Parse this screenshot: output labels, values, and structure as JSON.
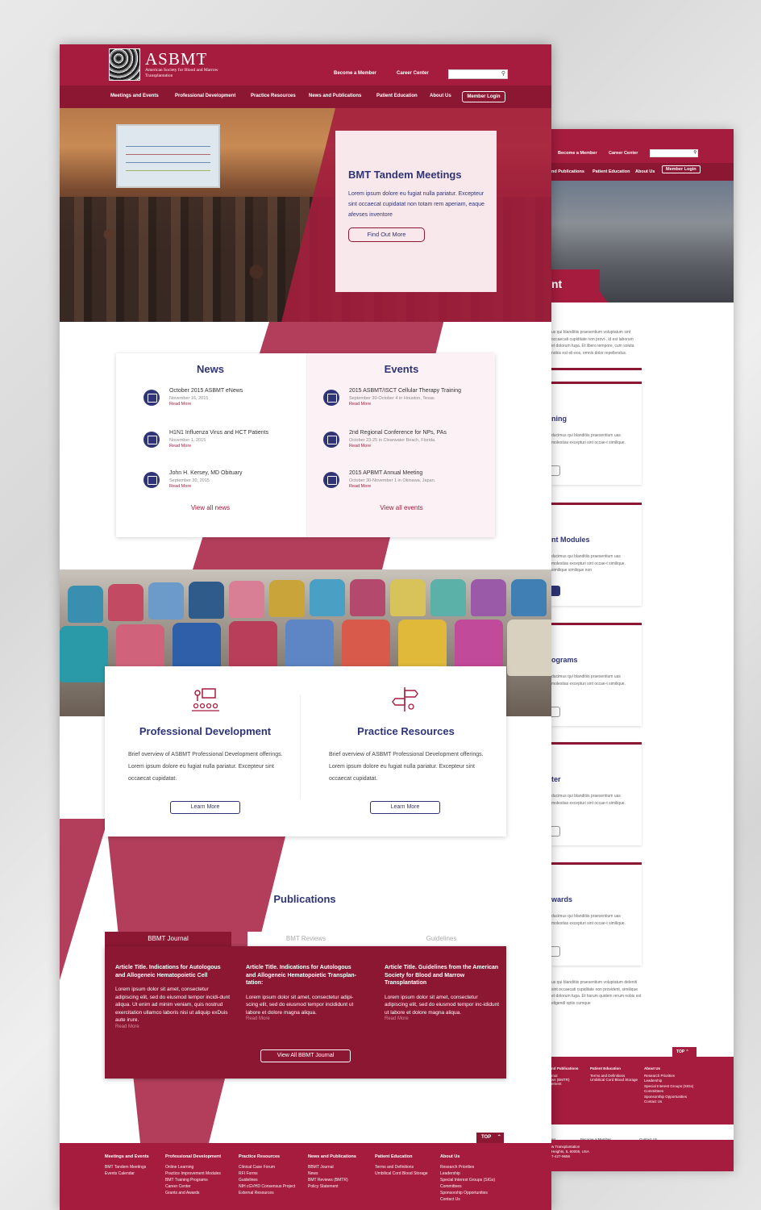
{
  "header": {
    "logo_text": "ASBMT",
    "logo_tm": "TM",
    "logo_subtitle": "American Society for Blood and Marrow Transplantation",
    "become_member": "Become a Member",
    "career_center": "Career Center",
    "search_icon": "magnifier-icon"
  },
  "nav": {
    "items": [
      "Meetings and Events",
      "Professional Development",
      "Practice Resources",
      "News and  Publications",
      "Patient Education",
      "About Us"
    ],
    "login": "Member Login"
  },
  "hero": {
    "title": "BMT Tandem Meetings",
    "body": "Lorem ipsum dolore eu fugiat nulla pariatur. Excepteur sint occaecat cupidatat non totam rem aperiam, eaque afevses inventore",
    "button": "Find Out More"
  },
  "news": {
    "title": "News",
    "items": [
      {
        "title": "October 2015 ASBMT eNews",
        "date": "November 16, 2015",
        "more": "Read More"
      },
      {
        "title": "H1N1 Influenza Virus and HCT Patients",
        "date": "November 1, 2015",
        "more": "Read More"
      },
      {
        "title": "John H. Kersey, MD Obituary",
        "date": "September 30, 2015",
        "more": "Read More"
      }
    ],
    "view_all": "View all news"
  },
  "events": {
    "title": "Events",
    "items": [
      {
        "title": "2015 ASBMT/ISCT Cellular Therapy Training",
        "date": "September 30-October 4 in Houston, Texas.",
        "more": "Read More"
      },
      {
        "title": "2nd Regional Conference for NPs, PAs",
        "date": "October 23-25 in Clearwater Beach, Florida.",
        "more": "Read More"
      },
      {
        "title": "2015 APBMT Annual Meeting",
        "date": "October 30-November 1 in Okinawa, Japan.",
        "more": "Read More"
      }
    ],
    "view_all": "View all events"
  },
  "features": [
    {
      "title": "Professional Development",
      "body": "Brief overview of ASBMT Professional Development offerings.  Lorem ipsum dolore eu fugiat nulla pariatur. Excepteur sint occaecat cupidatat.",
      "button": "Learn More"
    },
    {
      "title": "Practice Resources",
      "body": "Brief overview of ASBMT Professional Development offerings.  Lorem ipsum dolore eu fugiat nulla pariatur. Excepteur sint occaecat cupidatat.",
      "button": "Learn More"
    }
  ],
  "publications": {
    "title": "Publications",
    "tabs": [
      "BBMT Journal",
      "BMT Reviews",
      "Guidelines"
    ],
    "articles": [
      {
        "title": "Article Title. Indications for Autologous and Allogeneic Hematopoietic Cell",
        "body": "Lorem ipsum dolor sit amet, consectetur adipiscing elit, sed do eiusmod tempor incidi-dunt  aliqua. Ut enim ad minim veniam, quis nostrud exercitation ullamco laboris nisi ut aliquip exDuis aute irure.",
        "more": "Read More"
      },
      {
        "title": "Article Title. Indications for Autologous and Allogeneic Hematopoietic Transplan-tation:",
        "body": "Lorem ipsum dolor sit amet, consectetur adipi-scing elit, sed do eiusmod tempor incididunt ut labore et dolore magna aliqua.",
        "more": "Read More"
      },
      {
        "title": "Article Title. Guidelines from the American Society for Blood and Marrow Transplantation",
        "body": "Lorem ipsum dolor sit amet, consectetur adipiscing elit, sed do eiusmod tempor inc-ididunt ut labore et dolore magna aliqua.",
        "more": "Read More"
      }
    ],
    "view_all": "View All BBMT Journal"
  },
  "top_label": "TOP",
  "footer": {
    "columns": [
      {
        "heading": "Meetings and Events",
        "links": [
          "BMT Tandem Meetings",
          "Events Calendar"
        ]
      },
      {
        "heading": "Professional Development",
        "links": [
          "Online Learning",
          "Practice Improvement Modules",
          "BMT Training Programs",
          "Career Center",
          "Grants and Awards"
        ]
      },
      {
        "heading": "Practice Resources",
        "links": [
          "Clinical Case Forum",
          "RFI Forms",
          "Guidelines",
          "NIH cGVHD Consensus Project",
          "External Resources"
        ]
      },
      {
        "heading": "News and Publications",
        "links": [
          "BBMT Journal",
          "News",
          "BMT Reviews (BMTR)",
          "Policy Statement"
        ]
      },
      {
        "heading": "Patient Education",
        "links": [
          "Terms and Definitions",
          "Umbilical Cord Blood Storage"
        ]
      },
      {
        "heading": "About Us",
        "links": [
          "Research Priorities",
          "Leadership",
          "Special Interest Groups (SIGs)",
          "Committees",
          "Sponsorship Opportunities",
          "Contact Us"
        ]
      }
    ]
  },
  "back_page": {
    "become_member": "Become a Member",
    "career_center": "Career Center",
    "nav": [
      "nd Publications",
      "Patient Education",
      "About Us"
    ],
    "login": "Member Login",
    "hero_fragment": "nt",
    "intro": "us qui blanditiis praesentium voluptatum sint occaecati cupiditate non provi-, id est laborum et dolorum fuga. Et libero tempore, cum soluta nobis est eli-eos, omnis dolor repellendus.",
    "cards": [
      {
        "title": "ning",
        "body": "ducimus qui blanditiis praesentium uas molestias excepturi sint occae-t similique."
      },
      {
        "title": "nt Modules",
        "body": "ducimus qui blanditiis praesentium uas molestias excepturi sint occae-t similique. similique similique non"
      },
      {
        "title": "ograms",
        "body": "ducimus qui blanditiis praesentium uas molestias excepturi sint occae-t similique."
      },
      {
        "title": "ter",
        "body": "ducimus qui blanditiis praesentium uas molestias excepturi sint occae-t similique."
      },
      {
        "title": "wards",
        "body": "ducimus qui blanditiis praesentium uas molestias excepturi sint occae-t similique."
      }
    ],
    "outro": "us qui blanditiis praesentium voluptatum deleniti sint occaecati cupiditate non provident, similique et dolorum fuga. Et harum quidem rerum nobis est eligendi optio cumque",
    "top": "TOP",
    "footer_headings": [
      "nd Publications",
      "Patient Education",
      "About Us"
    ],
    "footer_links_1": [
      "rnal",
      "",
      "ws (BMTR)",
      "ement"
    ],
    "footer_links_2": [
      "Terms and Definitions",
      "Umbilical Cord Blood Storage"
    ],
    "footer_links_3": [
      "Research Priorities",
      "Leadership",
      "Special Interest Groups (SIGs)",
      "Committees",
      "Sponsorship Opportunities",
      "Contact Us"
    ],
    "follow_fragment": "ws",
    "become_member_2": "Become a Member",
    "contact_us": "Contact Us",
    "address": [
      "w Transplantation",
      "Heights, IL 60005, USA",
      "7-427-9656"
    ]
  },
  "colors": {
    "maroon": "#a51c3e",
    "dark_maroon": "#8b1733",
    "navy": "#2e3476"
  }
}
